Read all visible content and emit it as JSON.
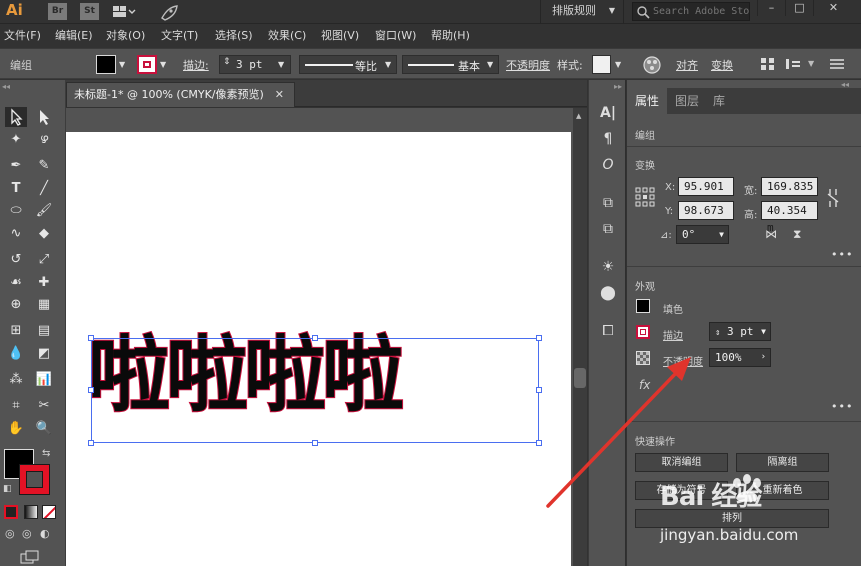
{
  "app": {
    "logo": "Ai",
    "bridge": "Br",
    "stock_tile": "St",
    "workspace": "排版规则",
    "stock_search_placeholder": "Search Adobe Stock"
  },
  "menu": [
    "文件(F)",
    "编辑(E)",
    "对象(O)",
    "文字(T)",
    "选择(S)",
    "效果(C)",
    "视图(V)",
    "窗口(W)",
    "帮助(H)"
  ],
  "control": {
    "selection_type": "编组",
    "stroke_label": "描边:",
    "stroke_weight": "3 pt",
    "profile_label": "等比",
    "brush_label": "基本",
    "opacity_label": "不透明度",
    "style_label": "样式:",
    "align_label": "对齐",
    "transform_label": "变换"
  },
  "document": {
    "tab_title": "未标题-1* @ 100% (CMYK/像素预览)",
    "artwork_text": "啦啦啦啦"
  },
  "panel": {
    "tabs": [
      "属性",
      "图层",
      "库"
    ],
    "group_label": "编组",
    "transform_title": "变换",
    "x_label": "X:",
    "x": "95.901 m",
    "y_label": "Y:",
    "y": "98.673 m",
    "w_label": "宽:",
    "w": "169.835",
    "h_label": "高:",
    "h": "40.354 m",
    "angle_label": "⊿:",
    "angle": "0°",
    "appearance_title": "外观",
    "fill_label": "填色",
    "stroke_label": "描边",
    "stroke_weight": "3 pt",
    "opacity_label": "不透明度",
    "opacity": "100%",
    "fx_label": "fx",
    "quick_actions_title": "快速操作",
    "ungroup": "取消编组",
    "isolate": "隔离组",
    "save_symbol": "存储为符号",
    "recolor": "重新着色",
    "arrange": "排列"
  },
  "watermark": {
    "brand": "Bai 经验",
    "url": "jingyan.baidu.com"
  },
  "colors": {
    "accent_stroke": "#c8103c",
    "selection_blue": "#4a6ef0",
    "annotation_arrow": "#e0342c"
  }
}
